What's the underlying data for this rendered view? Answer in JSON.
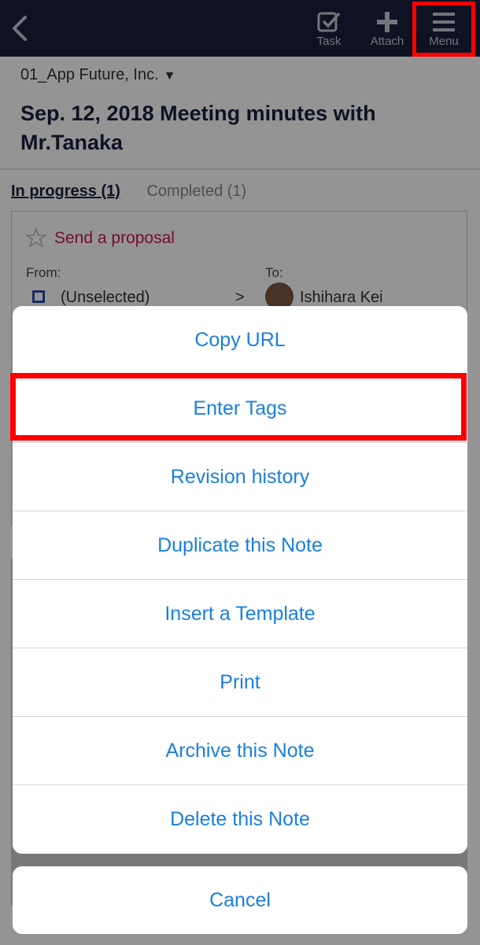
{
  "toolbar": {
    "task_label": "Task",
    "attach_label": "Attach",
    "menu_label": "Menu"
  },
  "note": {
    "folder": "01_App Future, Inc.",
    "title": "Sep. 12, 2018 Meeting minutes with Mr.Tanaka"
  },
  "tabs": [
    {
      "label": "In progress (1)",
      "active": true
    },
    {
      "label": "Completed (1)",
      "active": false
    }
  ],
  "task": {
    "title": "Send a proposal",
    "from_label": "From:",
    "from_value": "(Unselected)",
    "arrow": ">",
    "to_label": "To:",
    "to_value": "Ishihara Kei"
  },
  "menu": {
    "items": [
      {
        "label": "Copy URL"
      },
      {
        "label": "Enter Tags"
      },
      {
        "label": "Revision history"
      },
      {
        "label": "Duplicate this Note"
      },
      {
        "label": "Insert a Template"
      },
      {
        "label": "Print"
      },
      {
        "label": "Archive this Note"
      },
      {
        "label": "Delete this Note"
      }
    ],
    "cancel_label": "Cancel"
  },
  "colors": {
    "topbar": "#1a1f3d",
    "action_text": "#1a7fe0",
    "highlight": "#ff0000",
    "task_title": "#c51a4a"
  }
}
